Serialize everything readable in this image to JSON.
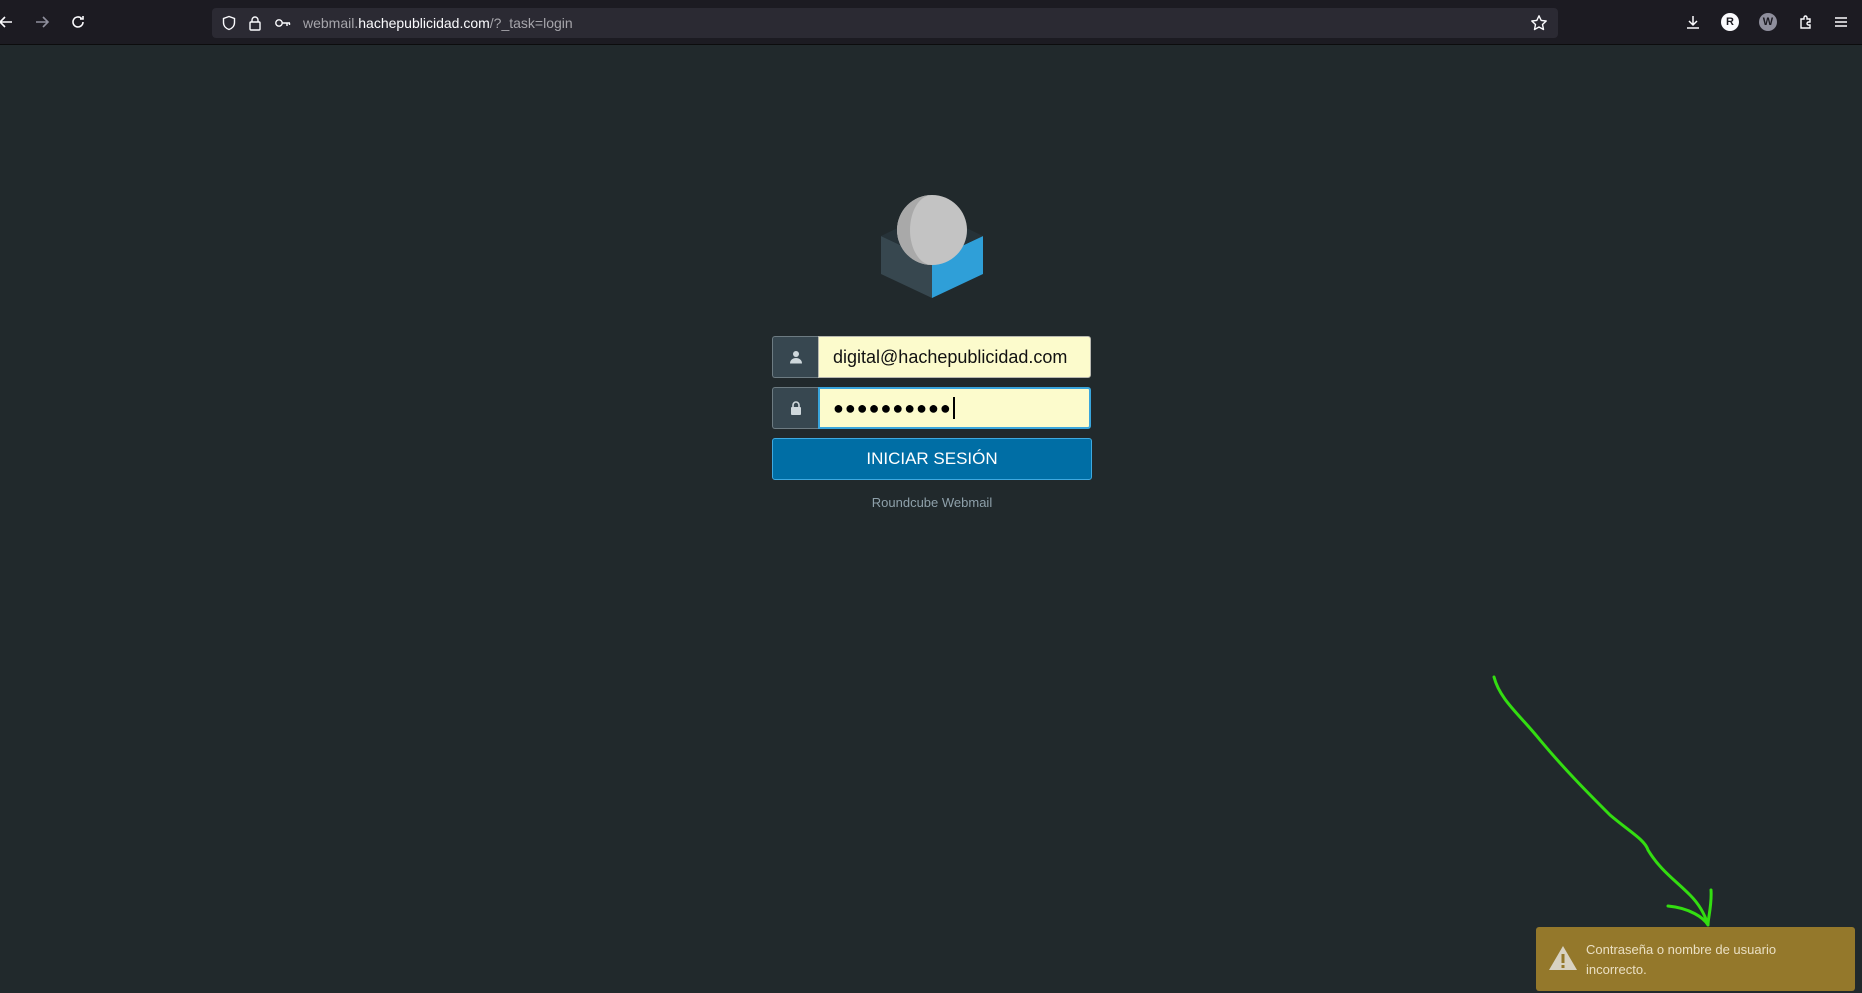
{
  "browser": {
    "url_prefix": "webmail.",
    "url_domain": "hachepublicidad.com",
    "url_path": "/?_task=login",
    "profile_initial": "R",
    "extension_initial": "W"
  },
  "login": {
    "username_value": "digital@hachepublicidad.com",
    "password_masked": "●●●●●●●●●●",
    "submit_label": "INICIAR SESIÓN",
    "product_name": "Roundcube Webmail"
  },
  "notification": {
    "message": "Contraseña o nombre de usuario incorrecto.",
    "type": "warning",
    "icon": "warning-icon"
  },
  "colors": {
    "background": "#21292c",
    "accent": "#006ea5",
    "input_autofill": "#fcfbcc",
    "warning": "#94782b",
    "annotation": "#33dd11"
  }
}
